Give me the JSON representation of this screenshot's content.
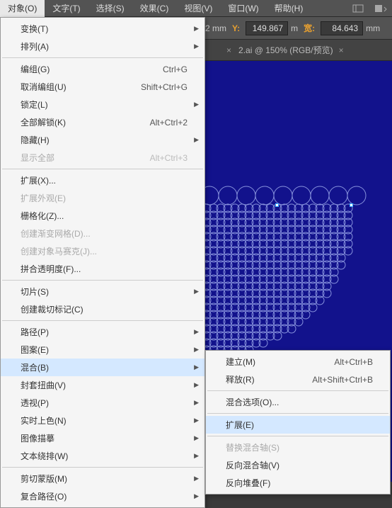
{
  "menubar": {
    "items": [
      "对象(O)",
      "文字(T)",
      "选择(S)",
      "效果(C)",
      "视图(V)",
      "窗口(W)",
      "帮助(H)"
    ]
  },
  "options": {
    "y_label": "Y:",
    "y_value": "149.867",
    "w_label": "宽:",
    "w_value": "84.643",
    "unit1": "2 mm",
    "unit2": "m"
  },
  "tab": {
    "label": "2.ai @ 150% (RGB/预览)"
  },
  "menu": [
    {
      "t": "row",
      "label": "变换(T)",
      "sub": true
    },
    {
      "t": "row",
      "label": "排列(A)",
      "sub": true
    },
    {
      "t": "sep"
    },
    {
      "t": "row",
      "label": "编组(G)",
      "sc": "Ctrl+G"
    },
    {
      "t": "row",
      "label": "取消编组(U)",
      "sc": "Shift+Ctrl+G"
    },
    {
      "t": "row",
      "label": "锁定(L)",
      "sub": true
    },
    {
      "t": "row",
      "label": "全部解锁(K)",
      "sc": "Alt+Ctrl+2"
    },
    {
      "t": "row",
      "label": "隐藏(H)",
      "sub": true
    },
    {
      "t": "row",
      "label": "显示全部",
      "sc": "Alt+Ctrl+3",
      "dis": true
    },
    {
      "t": "sep"
    },
    {
      "t": "row",
      "label": "扩展(X)..."
    },
    {
      "t": "row",
      "label": "扩展外观(E)",
      "dis": true
    },
    {
      "t": "row",
      "label": "栅格化(Z)..."
    },
    {
      "t": "row",
      "label": "创建渐变网格(D)...",
      "dis": true
    },
    {
      "t": "row",
      "label": "创建对象马赛克(J)...",
      "dis": true
    },
    {
      "t": "row",
      "label": "拼合透明度(F)..."
    },
    {
      "t": "sep"
    },
    {
      "t": "row",
      "label": "切片(S)",
      "sub": true
    },
    {
      "t": "row",
      "label": "创建裁切标记(C)"
    },
    {
      "t": "sep"
    },
    {
      "t": "row",
      "label": "路径(P)",
      "sub": true
    },
    {
      "t": "row",
      "label": "图案(E)",
      "sub": true
    },
    {
      "t": "row",
      "label": "混合(B)",
      "sub": true,
      "hl": true
    },
    {
      "t": "row",
      "label": "封套扭曲(V)",
      "sub": true
    },
    {
      "t": "row",
      "label": "透视(P)",
      "sub": true
    },
    {
      "t": "row",
      "label": "实时上色(N)",
      "sub": true
    },
    {
      "t": "row",
      "label": "图像描摹",
      "sub": true
    },
    {
      "t": "row",
      "label": "文本绕排(W)",
      "sub": true
    },
    {
      "t": "sep"
    },
    {
      "t": "row",
      "label": "剪切蒙版(M)",
      "sub": true
    },
    {
      "t": "row",
      "label": "复合路径(O)",
      "sub": true
    }
  ],
  "submenu": [
    {
      "t": "row",
      "label": "建立(M)",
      "sc": "Alt+Ctrl+B"
    },
    {
      "t": "row",
      "label": "释放(R)",
      "sc": "Alt+Shift+Ctrl+B"
    },
    {
      "t": "sep"
    },
    {
      "t": "row",
      "label": "混合选项(O)..."
    },
    {
      "t": "sep"
    },
    {
      "t": "row",
      "label": "扩展(E)",
      "hl": true
    },
    {
      "t": "sep"
    },
    {
      "t": "row",
      "label": "替换混合轴(S)",
      "dis": true
    },
    {
      "t": "row",
      "label": "反向混合轴(V)"
    },
    {
      "t": "row",
      "label": "反向堆叠(F)"
    }
  ]
}
